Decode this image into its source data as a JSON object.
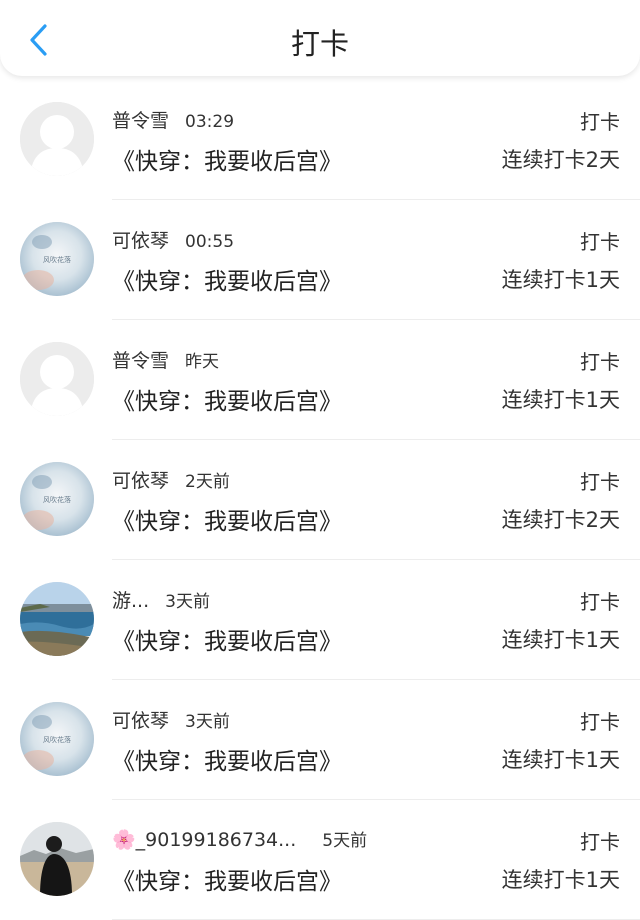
{
  "header": {
    "title": "打卡",
    "back_icon": "chevron-left-icon",
    "accent": "#2a9df4"
  },
  "rows": [
    {
      "user": "普令雪",
      "time": "03:29",
      "book": "《快穿：我要收后宫》",
      "action": "打卡",
      "streak": "连续打卡2天",
      "avatar": "default-avatar-icon"
    },
    {
      "user": "可依琴",
      "time": "00:55",
      "book": "《快穿：我要收后宫》",
      "action": "打卡",
      "streak": "连续打卡1天",
      "avatar": "blurred-photo-avatar"
    },
    {
      "user": "普令雪",
      "time": "昨天",
      "book": "《快穿：我要收后宫》",
      "action": "打卡",
      "streak": "连续打卡1天",
      "avatar": "default-avatar-icon"
    },
    {
      "user": "可依琴",
      "time": "2天前",
      "book": "《快穿：我要收后宫》",
      "action": "打卡",
      "streak": "连续打卡2天",
      "avatar": "blurred-photo-avatar"
    },
    {
      "user": "游...",
      "time": "3天前",
      "book": "《快穿：我要收后宫》",
      "action": "打卡",
      "streak": "连续打卡1天",
      "avatar": "seascape-photo-avatar"
    },
    {
      "user": "可依琴",
      "time": "3天前",
      "book": "《快穿：我要收后宫》",
      "action": "打卡",
      "streak": "连续打卡1天",
      "avatar": "blurred-photo-avatar"
    },
    {
      "user": "🌸_90199186734...",
      "time": "5天前",
      "book": "《快穿：我要收后宫》",
      "action": "打卡",
      "streak": "连续打卡1天",
      "avatar": "person-photo-avatar"
    }
  ]
}
